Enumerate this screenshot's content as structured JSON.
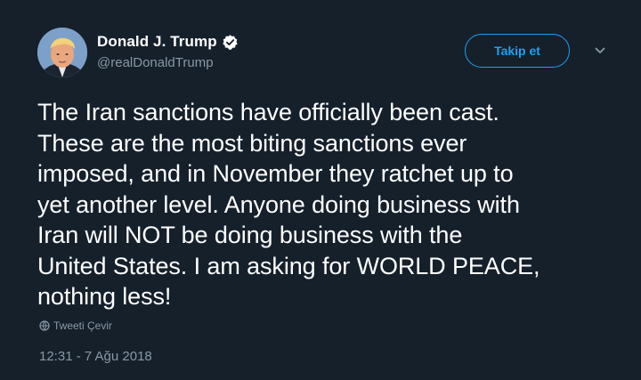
{
  "user": {
    "display_name": "Donald J. Trump",
    "handle": "@realDonaldTrump",
    "verified": true
  },
  "actions": {
    "follow_label": "Takip et"
  },
  "tweet": {
    "lines": [
      "The Iran sanctions have officially been cast.",
      "These are the most biting sanctions ever",
      "imposed, and in November they ratchet up to",
      "yet another level. Anyone doing business with",
      "Iran will NOT be doing business with the",
      "United States. I am asking for WORLD PEACE,",
      "nothing less!"
    ],
    "translate_label": "Tweeti Çevir",
    "timestamp": "12:31 - 7 Ağu 2018"
  },
  "icons": {
    "verified": "verified-badge-icon",
    "menu": "chevron-down-icon",
    "translate": "globe-icon"
  },
  "colors": {
    "background": "#15202b",
    "text": "#ffffff",
    "secondary": "#8899a6",
    "accent": "#1da1f2"
  }
}
